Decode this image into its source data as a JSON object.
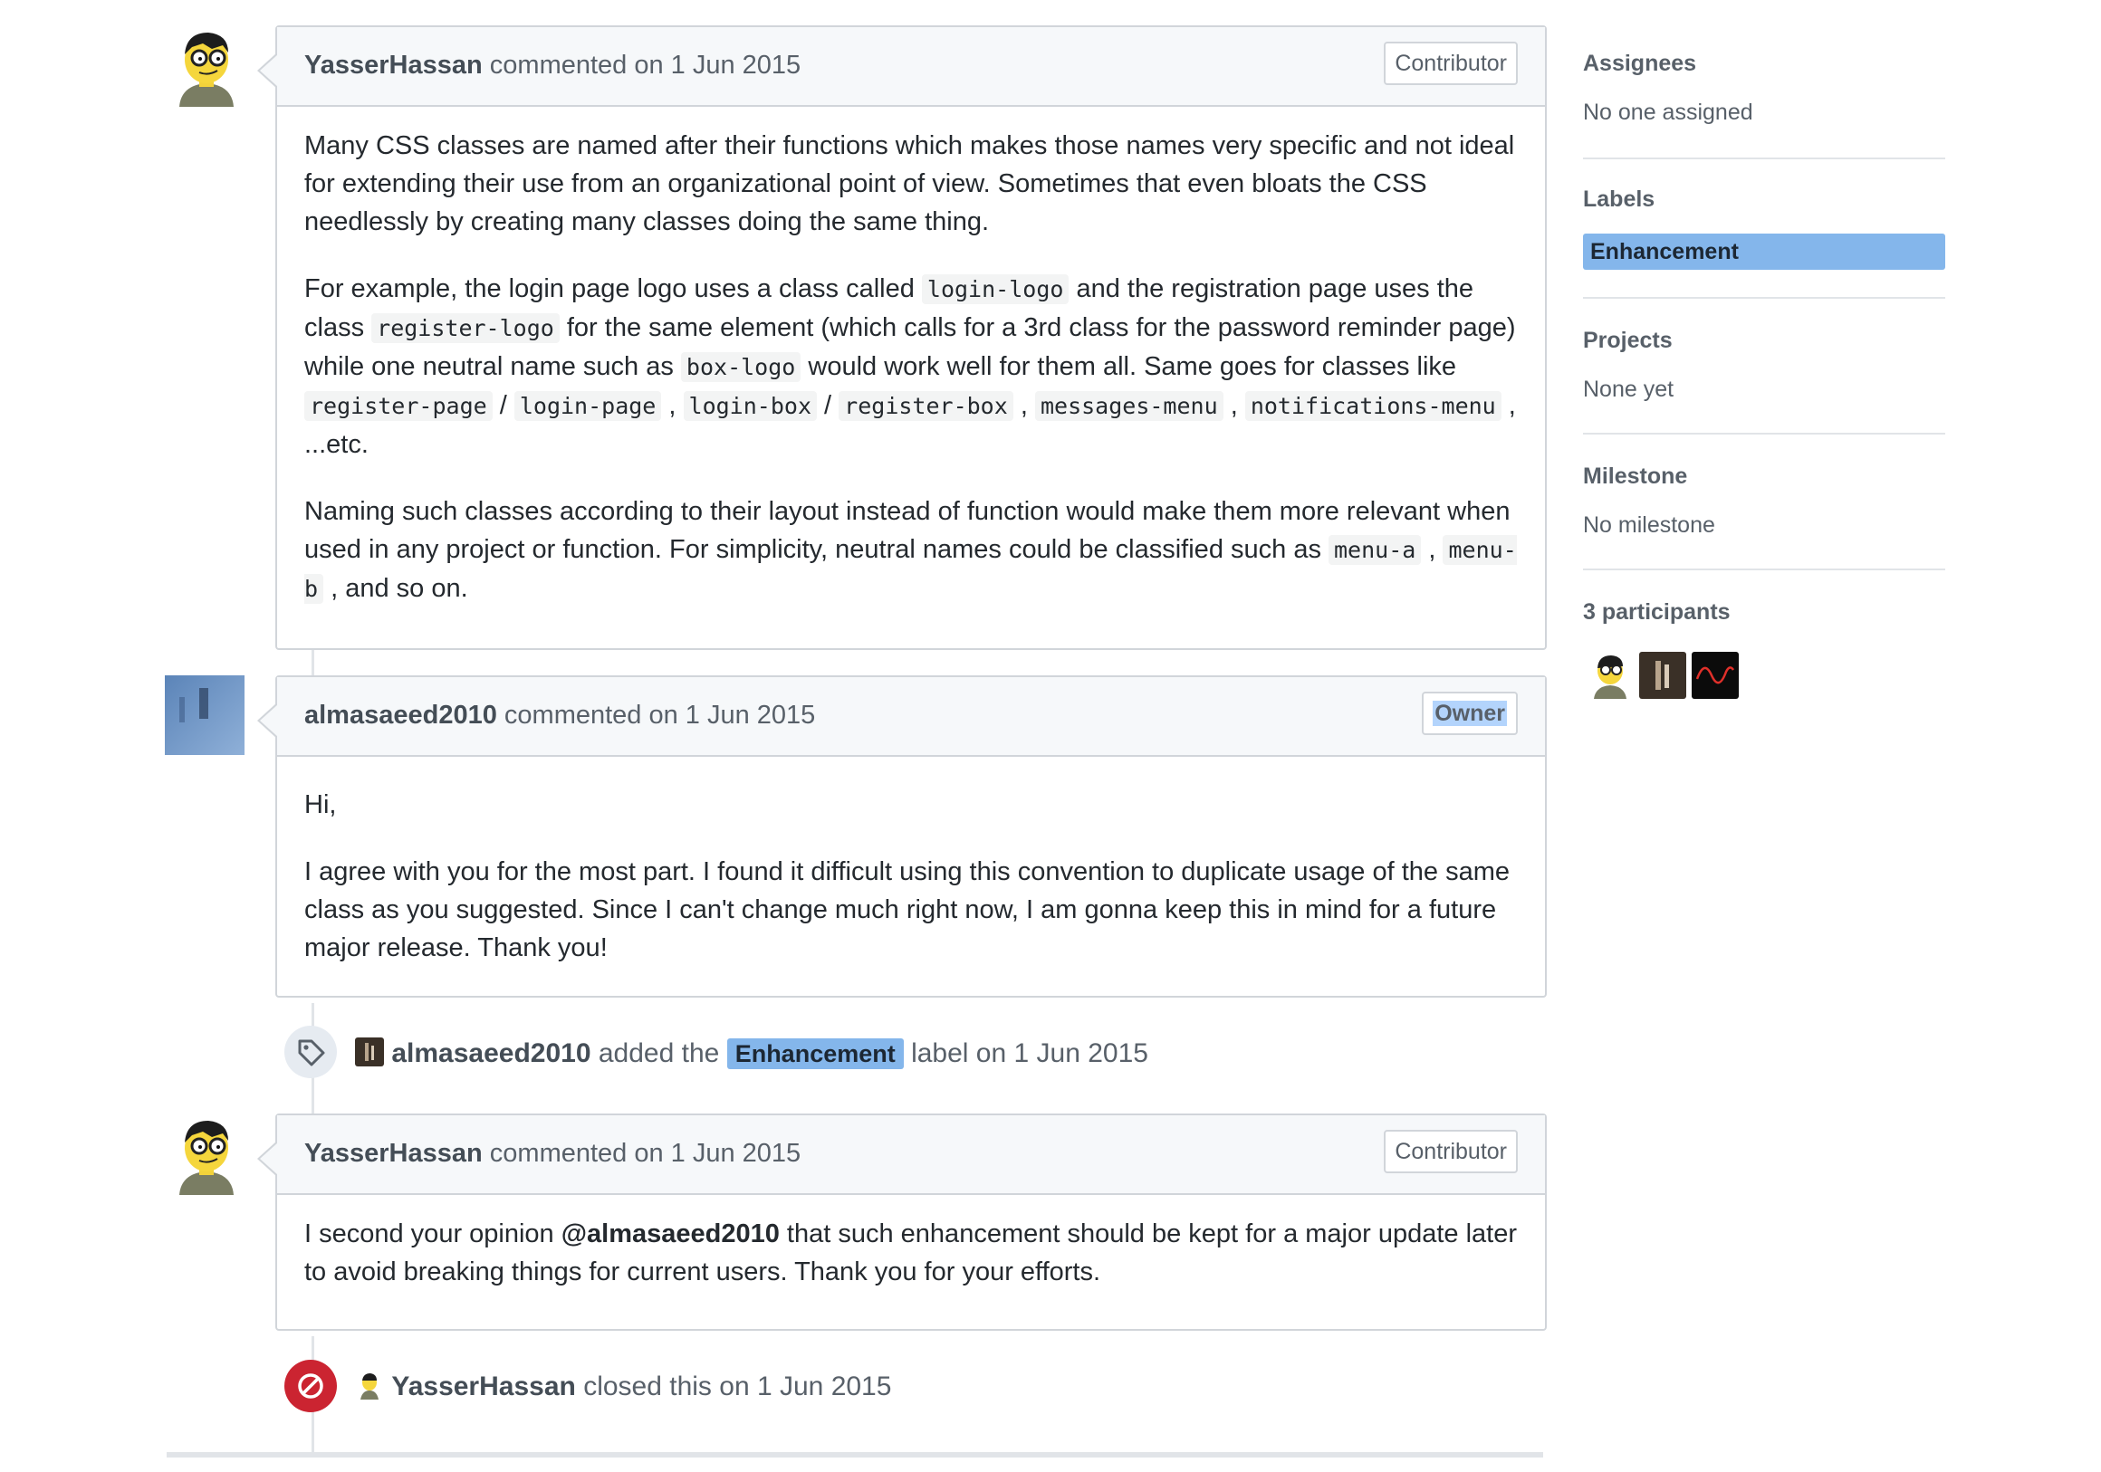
{
  "comments": [
    {
      "author": "YasserHassan",
      "action": "commented on 1 Jun 2015",
      "badge": "Contributor",
      "p1": "Many CSS classes are named after their functions which makes those names very specific and not ideal for extending their use from an organizational point of view. Sometimes that even bloats the CSS needlessly by creating many classes doing the same thing.",
      "p2_a": "For example, the login page logo uses a class called ",
      "code_login_logo": "login-logo",
      "p2_b": " and the registration page uses the class ",
      "code_register_logo": "register-logo",
      "p2_c": " for the same element (which calls for a 3rd class for the password reminder page) while one neutral name such as ",
      "code_box_logo": "box-logo",
      "p2_d": " would work well for them all. Same goes for classes like ",
      "code_register_page": "register-page",
      "slash1": " / ",
      "code_login_page": "login-page",
      "comma1": " , ",
      "code_login_box": "login-box",
      "slash2": " / ",
      "code_register_box": "register-box",
      "comma2": " , ",
      "code_messages_menu": "messages-menu",
      "comma3": " , ",
      "code_notifications_menu": "notifications-menu",
      "p2_e": " , ...etc.",
      "p3_a": "Naming such classes according to their layout instead of function would make them more relevant when used in any project or function. For simplicity, neutral names could be classified such as ",
      "code_menu_a": "menu-a",
      "comma4": " , ",
      "code_menu_b": "menu-b",
      "p3_b": " , and so on."
    },
    {
      "author": "almasaeed2010",
      "action": "commented on 1 Jun 2015",
      "badge": "Owner",
      "p1": "Hi,",
      "p2": "I agree with you for the most part. I found it difficult using this convention to duplicate usage of the same class as you suggested. Since I can't change much right now, I am gonna keep this in mind for a future major release. Thank you!"
    },
    {
      "author": "YasserHassan",
      "action": "commented on 1 Jun 2015",
      "badge": "Contributor",
      "p1_a": "I second your opinion ",
      "mention": "@almasaeed2010",
      "p1_b": " that such enhancement should be kept for a major update later to avoid breaking things for current users. Thank you for your efforts."
    }
  ],
  "events": {
    "label_event": {
      "actor": "almasaeed2010",
      "text_a": "added the",
      "label": "Enhancement",
      "text_b": "label on 1 Jun 2015",
      "icon": "tag-icon"
    },
    "close_event": {
      "actor": "YasserHassan",
      "text": "closed this on 1 Jun 2015",
      "icon": "closed-circle-icon",
      "color": "#cb2431"
    }
  },
  "sidebar": {
    "assignees_title": "Assignees",
    "assignees_value": "No one assigned",
    "labels_title": "Labels",
    "label_name": "Enhancement",
    "label_color": "#84b6eb",
    "projects_title": "Projects",
    "projects_value": "None yet",
    "milestone_title": "Milestone",
    "milestone_value": "No milestone",
    "participants_title": "3 participants"
  }
}
